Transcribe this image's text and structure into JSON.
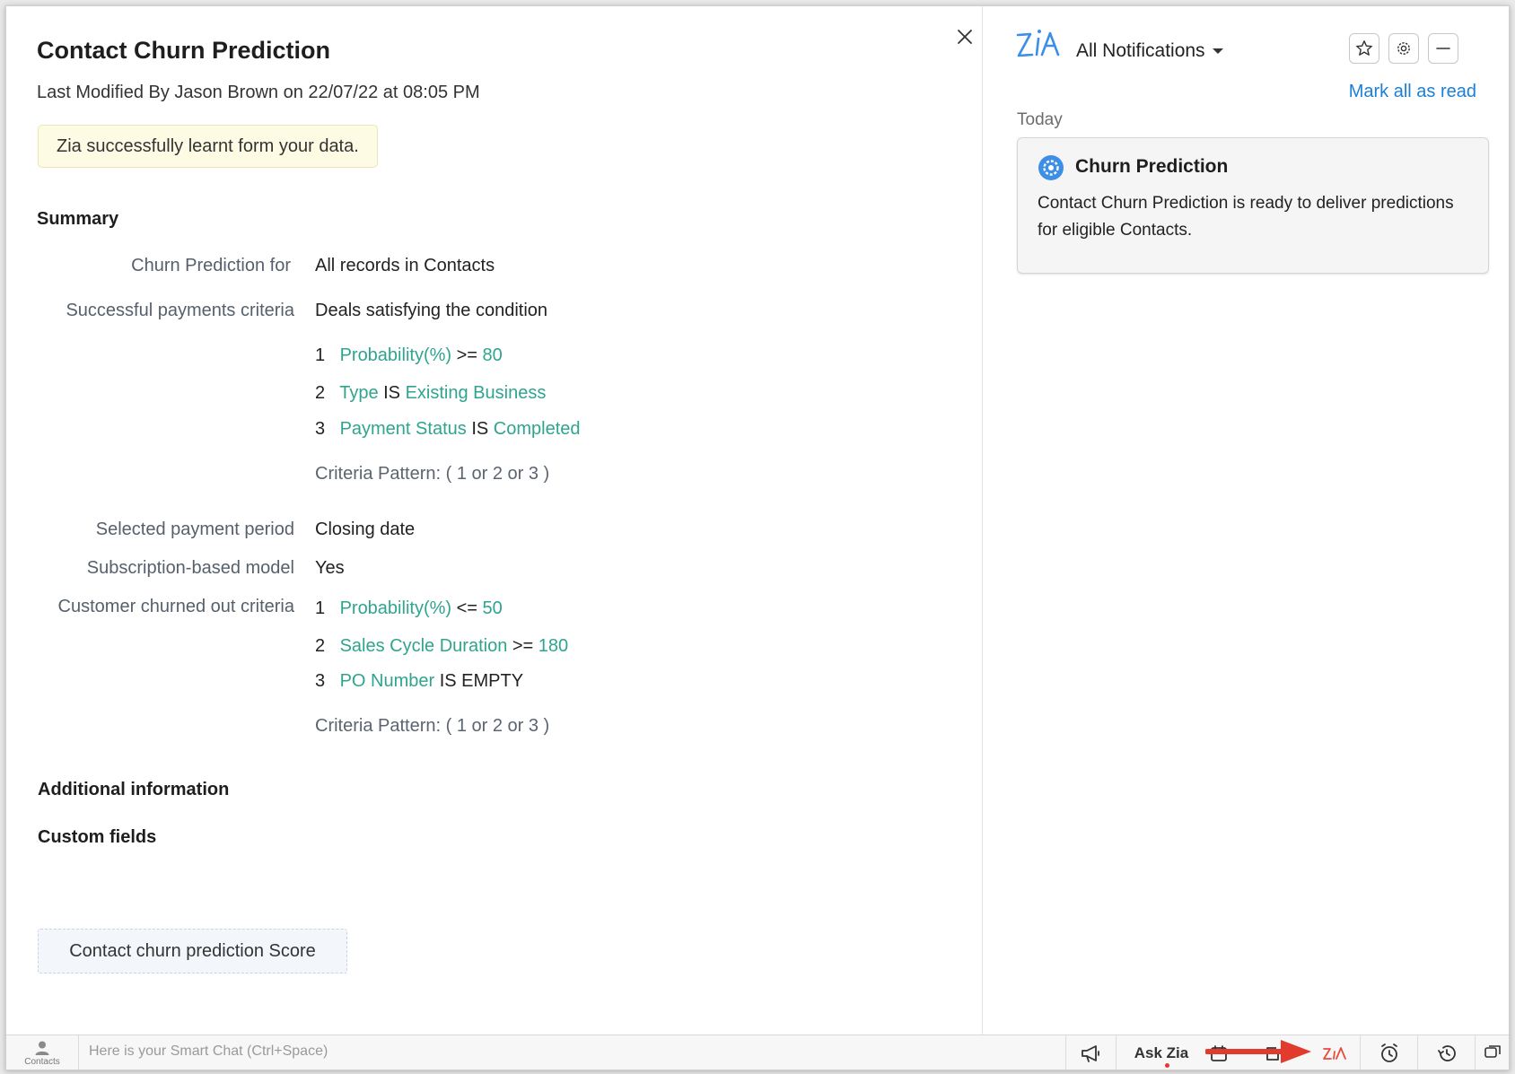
{
  "left_panel": {
    "title": "Contact Churn Prediction",
    "last_modified": "Last Modified By Jason Brown on 22/07/22 at 08:05 PM",
    "banner": "Zia successfully learnt form your data.",
    "summary_heading": "Summary",
    "fields": {
      "prediction_for_label": "Churn Prediction for",
      "prediction_for_value": "All records in Contacts",
      "payments_label": "Successful payments criteria",
      "payments_value": "Deals satisfying the condition",
      "payments_criteria": [
        {
          "num": "1",
          "field": "Probability(%)",
          "op": ">=",
          "value": "80"
        },
        {
          "num": "2",
          "field": "Type",
          "op": "IS",
          "value": "Existing Business"
        },
        {
          "num": "3",
          "field": "Payment Status",
          "op": "IS",
          "value": "Completed"
        }
      ],
      "payments_pattern": "Criteria Pattern: ( 1 or 2 or 3 )",
      "period_label": "Selected payment period",
      "period_value": "Closing date",
      "subscription_label": "Subscription-based model",
      "subscription_value": "Yes",
      "churned_label": "Customer churned out criteria",
      "churned_criteria": [
        {
          "num": "1",
          "field": "Probability(%)",
          "op": "<=",
          "value": "50"
        },
        {
          "num": "2",
          "field": "Sales Cycle Duration",
          "op": ">=",
          "value": "180"
        },
        {
          "num": "3",
          "field": "PO Number",
          "op": "IS EMPTY",
          "value": ""
        }
      ],
      "churned_pattern": "Criteria Pattern: ( 1 or 2 or 3 )"
    },
    "additional_heading": "Additional information",
    "custom_fields_heading": "Custom fields",
    "custom_field_chip": "Contact churn prediction Score"
  },
  "right_panel": {
    "dropdown_label": "All Notifications",
    "mark_all_read": "Mark all as read",
    "today_label": "Today",
    "notification": {
      "title": "Churn Prediction",
      "body": "Contact Churn Prediction is ready to deliver predictions for eligible Contacts."
    }
  },
  "bottom_bar": {
    "contacts_label": "Contacts",
    "smart_chat_placeholder": "Here is your Smart Chat (Ctrl+Space)",
    "ask_zia": "Ask Zia"
  },
  "colors": {
    "accent_teal": "#2fa48f",
    "link_blue": "#1a7fd6",
    "zia_red": "#e84c3d",
    "banner_yellow": "#fdfbe3"
  }
}
